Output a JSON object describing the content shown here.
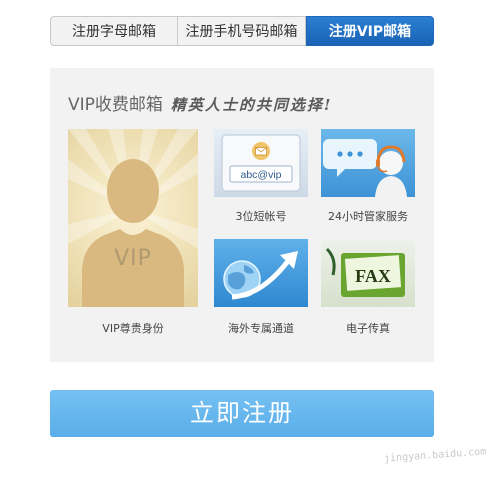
{
  "tabs": [
    {
      "label": "注册字母邮箱"
    },
    {
      "label": "注册手机号码邮箱"
    },
    {
      "label": "注册VIP邮箱",
      "active": true
    }
  ],
  "promo": {
    "title": "VIP收费邮箱",
    "slogan": "精英人士的共同选择!",
    "vip_card": {
      "badge": "VIP",
      "caption": "VIP尊贵身份"
    },
    "features": [
      {
        "caption": "3位短帐号",
        "tile_text": "abc@vip",
        "icon": "email-address-icon"
      },
      {
        "caption": "24小时管家服务",
        "icon": "customer-service-icon"
      },
      {
        "caption": "海外专属通道",
        "icon": "globe-arrow-icon"
      },
      {
        "caption": "电子传真",
        "tile_text": "FAX",
        "icon": "fax-icon"
      }
    ]
  },
  "register_button": {
    "label": "立即注册"
  },
  "watermark": "jingyan.baidu.com",
  "colors": {
    "active_tab": "#1a62b4",
    "button": "#5aaeea",
    "panel": "#f2f2f2"
  }
}
